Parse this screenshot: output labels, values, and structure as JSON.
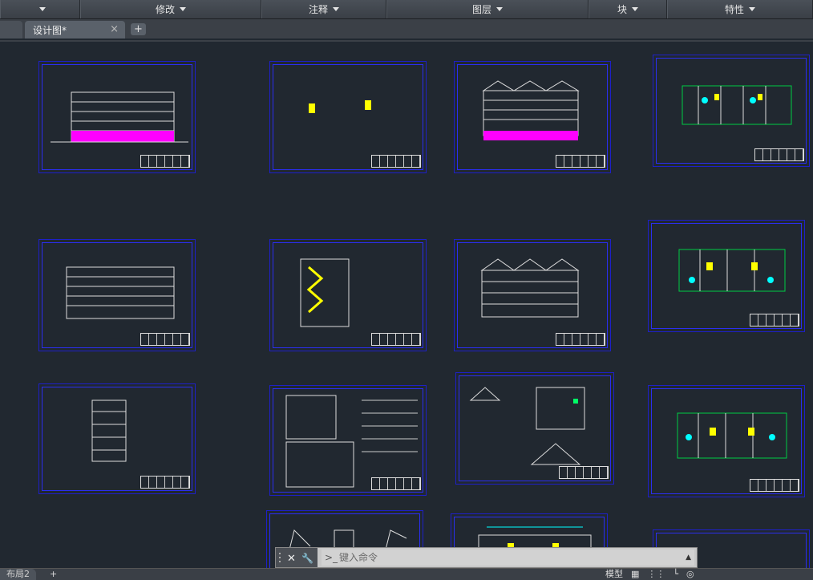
{
  "ribbon": {
    "panels": [
      {
        "label": ""
      },
      {
        "label": "修改"
      },
      {
        "label": "注释"
      },
      {
        "label": "图层"
      },
      {
        "label": "块"
      },
      {
        "label": "特性"
      }
    ]
  },
  "document_tab": {
    "label": "设计图*",
    "close": "×",
    "add": "+"
  },
  "command_line": {
    "placeholder": "键入命令",
    "prompt_icon": "command-prompt-icon"
  },
  "layout_tabs": {
    "current": "布局2",
    "add": "+"
  },
  "status_bar": {
    "model_label": "模型"
  },
  "colors": {
    "sheet_border": "#2b2ef0",
    "highlight_magenta": "#ff00ff",
    "highlight_yellow": "#ffff00",
    "highlight_cyan": "#00ffff"
  }
}
